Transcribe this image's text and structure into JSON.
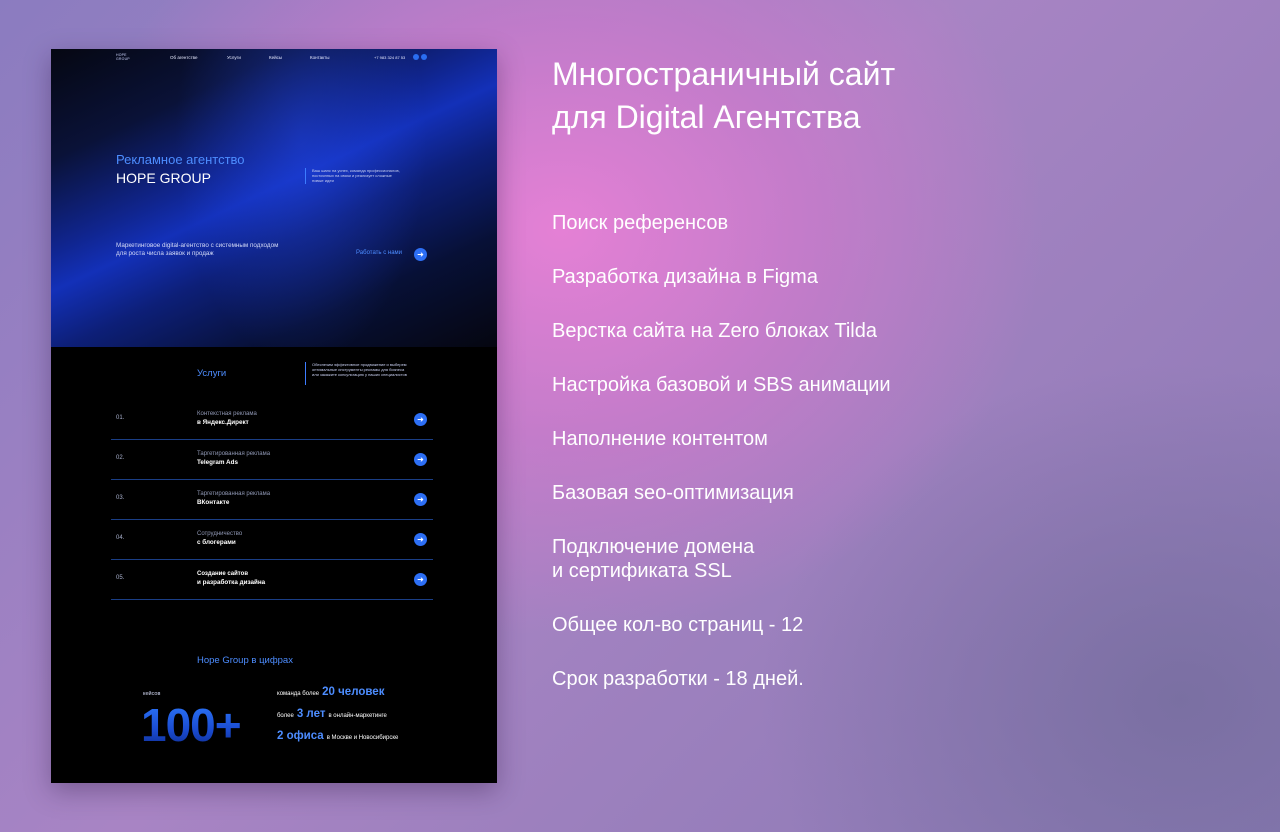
{
  "mockup": {
    "nav": {
      "logo": "HOPE GROUP",
      "items": [
        "Об агентстве",
        "Услуги",
        "Кейсы",
        "Контакты"
      ],
      "phone": "+7 983 324 87 53"
    },
    "hero": {
      "title_line1": "Рекламное агентство",
      "title_line2": "HOPE GROUP",
      "aside": "Ваш шанс на успех, команда профессионалов, постоянных на связи и реализует сложные новые идеи",
      "subtitle": "Маркетинговое digital-агентство с системным подходом для роста числа заявок и продаж",
      "cta": "Работать с нами"
    },
    "services": {
      "title": "Услуги",
      "aside": "Обеспечим эффективное продвижение и выберем оптимальные инструменты рекламы для бизнеса или закажите консультацию у наших специалистов",
      "rows": [
        {
          "num": "01.",
          "line1": "Контекстная реклама",
          "line2": "в Яндекс.Директ"
        },
        {
          "num": "02.",
          "line1": "Таргетированная реклама",
          "line2": "Telegram Ads"
        },
        {
          "num": "03.",
          "line1": "Таргетированная реклама",
          "line2": "ВКонтакте"
        },
        {
          "num": "04.",
          "line1": "Сотрудничество",
          "line2": "с блогерами"
        },
        {
          "num": "05.",
          "line1": "Создание сайтов",
          "line2": "и разработка дизайна"
        }
      ]
    },
    "stats": {
      "title": "Hope Group в цифрах",
      "cases_label": "кейсов",
      "cases_value": "100+",
      "team_pre": "команда более",
      "team_value": "20 человек",
      "years_pre": "более",
      "years_value": "3 лет",
      "years_post": "в онлайн-маркетинге",
      "offices_value": "2 офиса",
      "offices_post": "в Москве и Новосибирске"
    }
  },
  "right": {
    "title_line1": "Многостраничный сайт",
    "title_line2": "для Digital Агентства",
    "items": [
      "Поиск референсов",
      "Разработка  дизайна в Figma",
      "Верстка сайта на Zero блоках Tilda",
      "Настройка базовой и SBS анимации",
      "Наполнение контентом",
      "Базовая seo-оптимизация",
      "Подключение домена",
      "и сертификата SSL",
      "Общее кол-во страниц - 12",
      "Срок разработки - 18 дней."
    ]
  },
  "colors": {
    "accent": "#2d6ff5",
    "accent_text": "#4d8dff",
    "background_pink": "#e880d6",
    "background_violet": "#8b7cc0"
  }
}
